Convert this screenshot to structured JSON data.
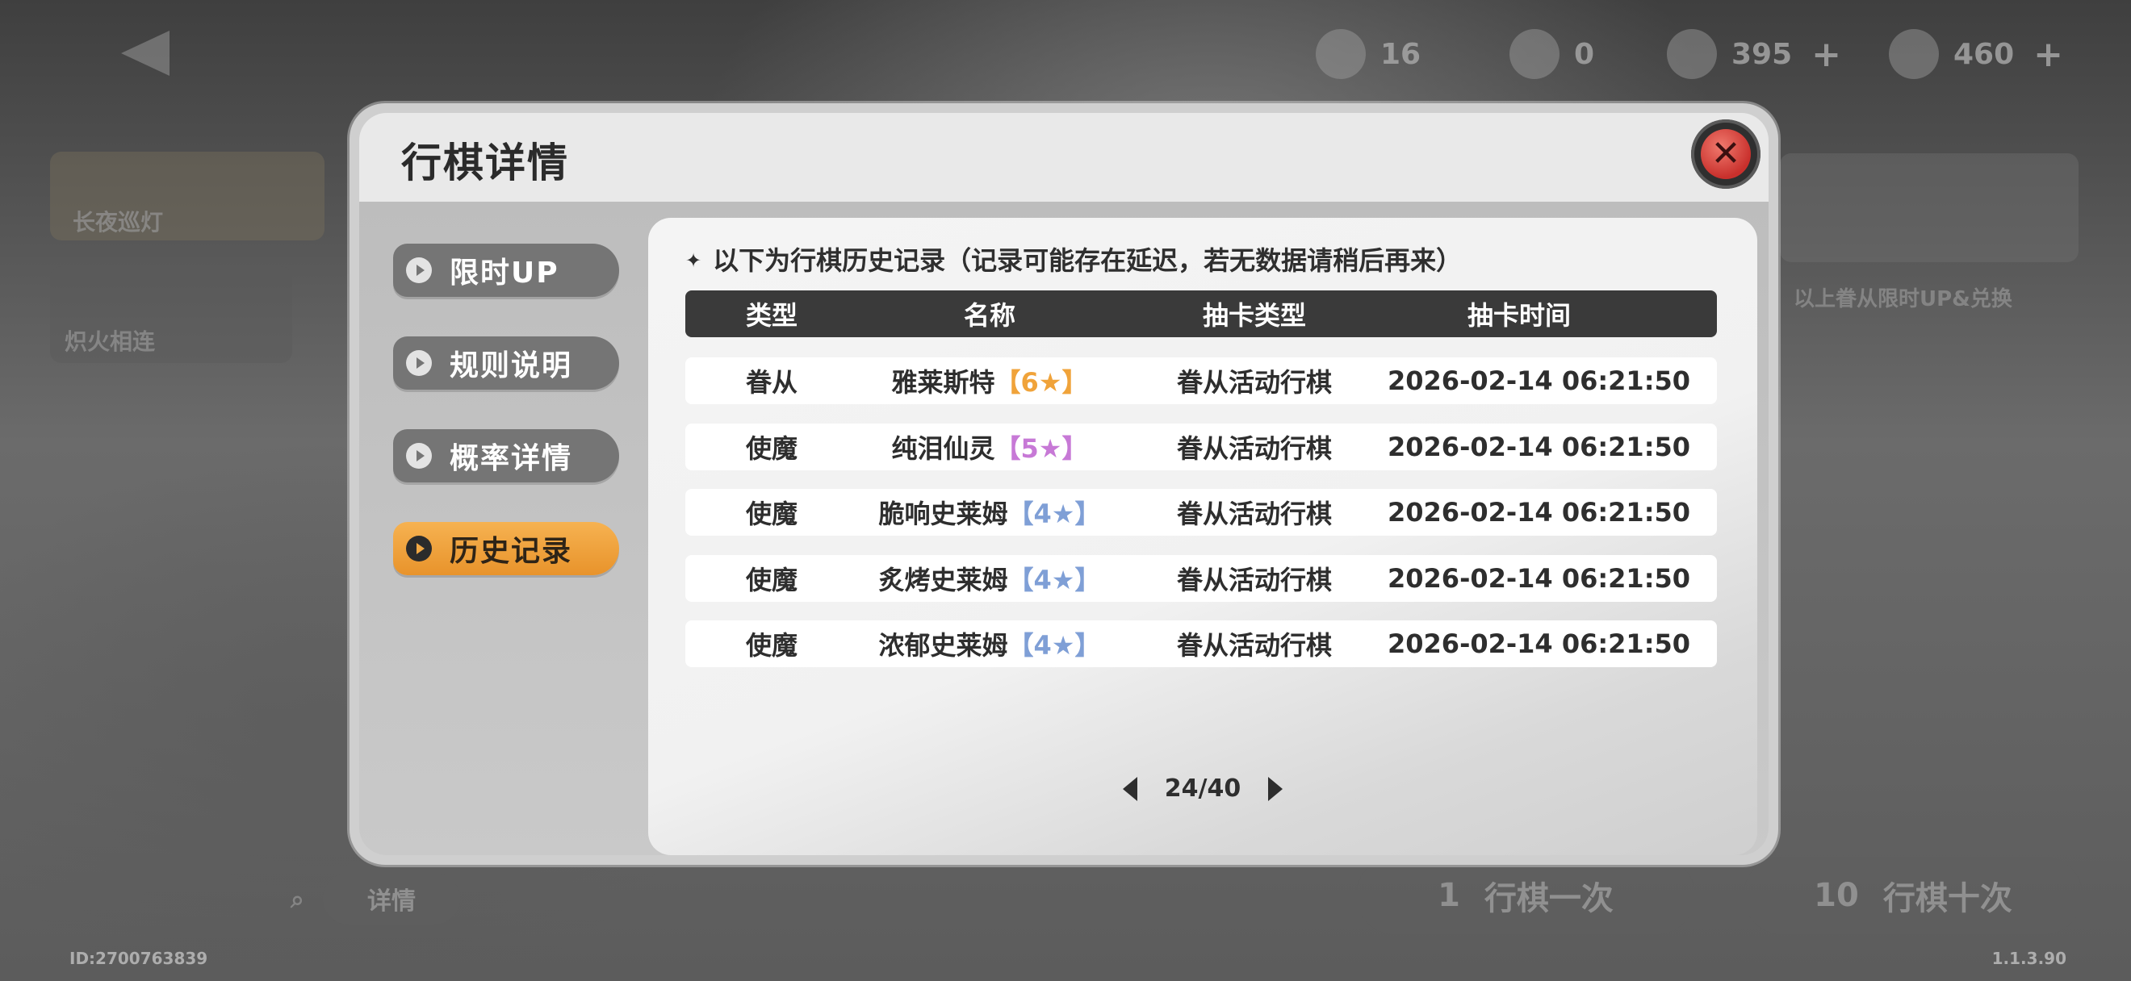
{
  "background": {
    "resources": [
      {
        "icon": "seal-icon",
        "value": "16",
        "plus": ""
      },
      {
        "icon": "feather-icon",
        "value": "0",
        "plus": ""
      },
      {
        "icon": "crystal-icon",
        "value": "395",
        "plus": "+"
      },
      {
        "icon": "gem-icon",
        "value": "460",
        "plus": "+"
      }
    ],
    "banner_label": "长夜巡灯",
    "banner_label_2": "炽火相连",
    "right_note": "以上眷从限时UP&兑换",
    "details_link": "详情",
    "draw_once": {
      "count": "1",
      "label": "行棋一次"
    },
    "draw_ten": {
      "count": "10",
      "label": "行棋十次"
    },
    "user_id": "ID:2700763839",
    "version": "1.1.3.90"
  },
  "modal": {
    "title": "行棋详情",
    "close_icon": "close-icon",
    "menu": [
      {
        "label": "限时UP",
        "active": false
      },
      {
        "label": "规则说明",
        "active": false
      },
      {
        "label": "概率详情",
        "active": false
      },
      {
        "label": "历史记录",
        "active": true
      }
    ],
    "notice": "以下为行棋历史记录（记录可能存在延迟，若无数据请稍后再来）",
    "notice_star": "✦",
    "columns": [
      "类型",
      "名称",
      "抽卡类型",
      "抽卡时间"
    ],
    "rows": [
      {
        "type": "眷从",
        "name": "雅莱斯特",
        "rarity": "【6★】",
        "rarity_color": "#f0a33a",
        "draw_type": "眷从活动行棋",
        "time": "2026-02-14 06:21:50"
      },
      {
        "type": "使魔",
        "name": "纯泪仙灵",
        "rarity": "【5★】",
        "rarity_color": "#c779d6",
        "draw_type": "眷从活动行棋",
        "time": "2026-02-14 06:21:50"
      },
      {
        "type": "使魔",
        "name": "脆响史莱姆",
        "rarity": "【4★】",
        "rarity_color": "#7f9fd6",
        "draw_type": "眷从活动行棋",
        "time": "2026-02-14 06:21:50"
      },
      {
        "type": "使魔",
        "name": "炙烤史莱姆",
        "rarity": "【4★】",
        "rarity_color": "#7f9fd6",
        "draw_type": "眷从活动行棋",
        "time": "2026-02-14 06:21:50"
      },
      {
        "type": "使魔",
        "name": "浓郁史莱姆",
        "rarity": "【4★】",
        "rarity_color": "#7f9fd6",
        "draw_type": "眷从活动行棋",
        "time": "2026-02-14 06:21:50"
      }
    ],
    "pager": {
      "current": 24,
      "total": 40,
      "text": "24/40"
    }
  }
}
